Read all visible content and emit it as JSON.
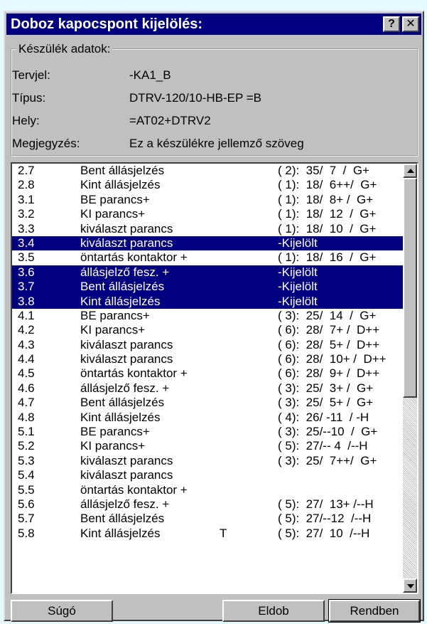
{
  "window": {
    "title": "Doboz kapocspont kijelölés:",
    "help_label": "?",
    "close_label": "✕"
  },
  "device": {
    "group_label": "Készülék adatok:",
    "fields": [
      {
        "label": "Tervjel:",
        "value": "-KA1_B"
      },
      {
        "label": "Típus:",
        "value": "DTRV-120/10-HB-EP =B"
      },
      {
        "label": "Hely:",
        "value": "=AT02+DTRV2"
      },
      {
        "label": "Megjegyzés:",
        "value": "Ez a készülékre jellemző szöveg"
      }
    ]
  },
  "list": {
    "rows": [
      {
        "id": "2.7",
        "name": "Bent állásjelzés",
        "extra": "",
        "ref": "( 2):  35/  7  /  G+",
        "selected": false
      },
      {
        "id": "2.8",
        "name": "Kint állásjelzés",
        "extra": "",
        "ref": "( 1):  18/  6++/  G+",
        "selected": false
      },
      {
        "id": "3.1",
        "name": "BE parancs+",
        "extra": "",
        "ref": "( 1):  18/  8+ /  G+",
        "selected": false
      },
      {
        "id": "3.2",
        "name": "KI parancs+",
        "extra": "",
        "ref": "( 1):  18/  12  /  G+",
        "selected": false
      },
      {
        "id": "3.3",
        "name": "kiválaszt parancs",
        "extra": "",
        "ref": "( 1):  18/  10  /  G+",
        "selected": false
      },
      {
        "id": "3.4",
        "name": "kiválaszt parancs",
        "extra": "",
        "ref": "-Kijelölt",
        "selected": true
      },
      {
        "id": "3.5",
        "name": "öntartás kontaktor +",
        "extra": "",
        "ref": "( 1):  18/  16  /  G+",
        "selected": false
      },
      {
        "id": "3.6",
        "name": "állásjelző fesz. +",
        "extra": "",
        "ref": "-Kijelölt",
        "selected": true
      },
      {
        "id": "3.7",
        "name": "Bent állásjelzés",
        "extra": "",
        "ref": "-Kijelölt",
        "selected": true
      },
      {
        "id": "3.8",
        "name": "Kint állásjelzés",
        "extra": "",
        "ref": "-Kijelölt",
        "selected": true
      },
      {
        "id": "4.1",
        "name": "BE parancs+",
        "extra": "",
        "ref": "( 3):  25/  14  /  G+",
        "selected": false
      },
      {
        "id": "4.2",
        "name": "KI parancs+",
        "extra": "",
        "ref": "( 6):  28/  7+ /  D++",
        "selected": false
      },
      {
        "id": "4.3",
        "name": "kiválaszt parancs",
        "extra": "",
        "ref": "( 6):  28/  5+ /  D++",
        "selected": false
      },
      {
        "id": "4.4",
        "name": "kiválaszt parancs",
        "extra": "",
        "ref": "( 6):  28/  10+ /  D++",
        "selected": false
      },
      {
        "id": "4.5",
        "name": "öntartás kontaktor +",
        "extra": "",
        "ref": "( 6):  28/  9+ /  D++",
        "selected": false
      },
      {
        "id": "4.6",
        "name": "állásjelző fesz. +",
        "extra": "",
        "ref": "( 3):  25/  3+ /  G+",
        "selected": false
      },
      {
        "id": "4.7",
        "name": "Bent állásjelzés",
        "extra": "",
        "ref": "( 3):  25/  5+ /  G+",
        "selected": false
      },
      {
        "id": "4.8",
        "name": "Kint állásjelzés",
        "extra": "",
        "ref": "( 4):  26/ -11  / -H",
        "selected": false
      },
      {
        "id": "5.1",
        "name": "BE parancs+",
        "extra": "",
        "ref": "( 3):  25/--10  /  G+",
        "selected": false
      },
      {
        "id": "5.2",
        "name": "KI parancs+",
        "extra": "",
        "ref": "( 5):  27/-- 4  /--H",
        "selected": false
      },
      {
        "id": "5.3",
        "name": "kiválaszt parancs",
        "extra": "",
        "ref": "( 3):  25/  7++/  G+",
        "selected": false
      },
      {
        "id": "5.4",
        "name": "kiválaszt parancs",
        "extra": "",
        "ref": "",
        "selected": false
      },
      {
        "id": "5.5",
        "name": "öntartás kontaktor +",
        "extra": "",
        "ref": "",
        "selected": false
      },
      {
        "id": "5.6",
        "name": "állásjelző fesz. +",
        "extra": "",
        "ref": "( 5):  27/  13+ /--H",
        "selected": false
      },
      {
        "id": "5.7",
        "name": "Bent állásjelzés",
        "extra": "",
        "ref": "( 5):  27/--12  /--H",
        "selected": false
      },
      {
        "id": "5.8",
        "name": "Kint állásjelzés",
        "extra": "T",
        "ref": "( 5):  27/  10  /--H",
        "selected": false
      }
    ]
  },
  "buttons": {
    "help": "Súgó",
    "cancel": "Eldob",
    "ok": "Rendben"
  },
  "colors": {
    "selection": "#000080",
    "titlebar": "#000080",
    "face": "#c0c0c0",
    "desktop": "#e6fbff"
  }
}
